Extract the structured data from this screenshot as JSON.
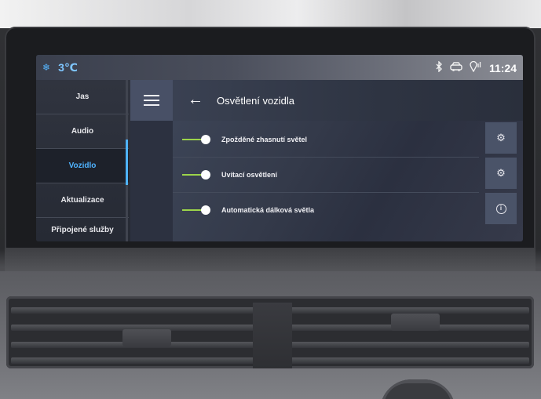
{
  "status_bar": {
    "temperature": "3℃",
    "time": "11:24",
    "icons": [
      "snowflake-icon",
      "bluetooth-icon",
      "car-connect-icon",
      "location-signal-icon"
    ]
  },
  "menu": {
    "items": [
      {
        "label": "Jas",
        "active": false
      },
      {
        "label": "Audio",
        "active": false
      },
      {
        "label": "Vozidlo",
        "active": true
      },
      {
        "label": "Aktualizace",
        "active": false
      },
      {
        "label": "Připojené služby",
        "active": false
      }
    ]
  },
  "header": {
    "title": "Osvětlení vozidla"
  },
  "settings": {
    "rows": [
      {
        "label": "Zpožděné zhasnutí světel",
        "enabled": true,
        "action_icon": "gear-icon"
      },
      {
        "label": "Uvítací osvětlení",
        "enabled": true,
        "action_icon": "gear-icon"
      },
      {
        "label": "Automatická dálková světla",
        "enabled": true,
        "action_icon": "info-icon"
      }
    ]
  },
  "colors": {
    "accent": "#4fb3ff",
    "toggle_on": "#9cd44a"
  }
}
